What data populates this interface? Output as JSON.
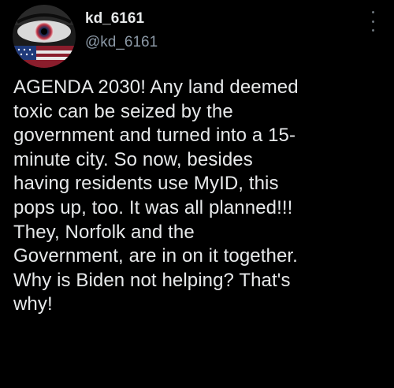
{
  "tweet": {
    "author": {
      "display_name": "kd_6161",
      "handle": "@kd_6161",
      "avatar_icon": "eye-flag-avatar"
    },
    "more_icon": "more-vertical-icon",
    "body": "AGENDA 2030! Any land deemed\ntoxic can be seized by the\ngovernment and turned into a 15-\nminute city. So now, besides\nhaving residents use MyID, this\npops up, too. It was all planned!!!\nThey, Norfolk and the\nGovernment, are in on it together.\nWhy is Biden not helping? That's\nwhy!"
  },
  "colors": {
    "background": "#000000",
    "text_primary": "#e7e9ea",
    "text_secondary": "#8b98a5"
  }
}
